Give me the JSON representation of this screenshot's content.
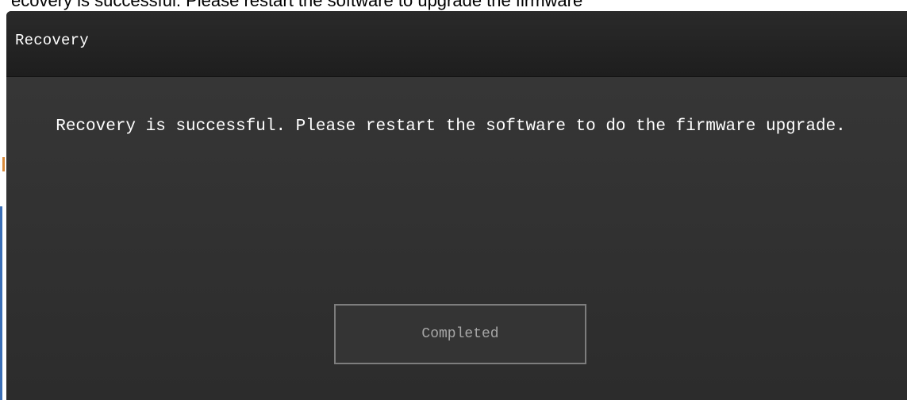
{
  "background_caption": "ecovery is successful. Please restart the software to upgrade the firmware",
  "dialog": {
    "title": "Recovery",
    "message": "Recovery is successful. Please restart the software to do the firmware upgrade.",
    "button_label": "Completed"
  },
  "colors": {
    "dialog_bg": "#2f2f2f",
    "titlebar_bg": "#1e1e1e",
    "text": "#ffffff",
    "button_border": "#7d7d7d",
    "button_text": "#a6a6a6"
  }
}
